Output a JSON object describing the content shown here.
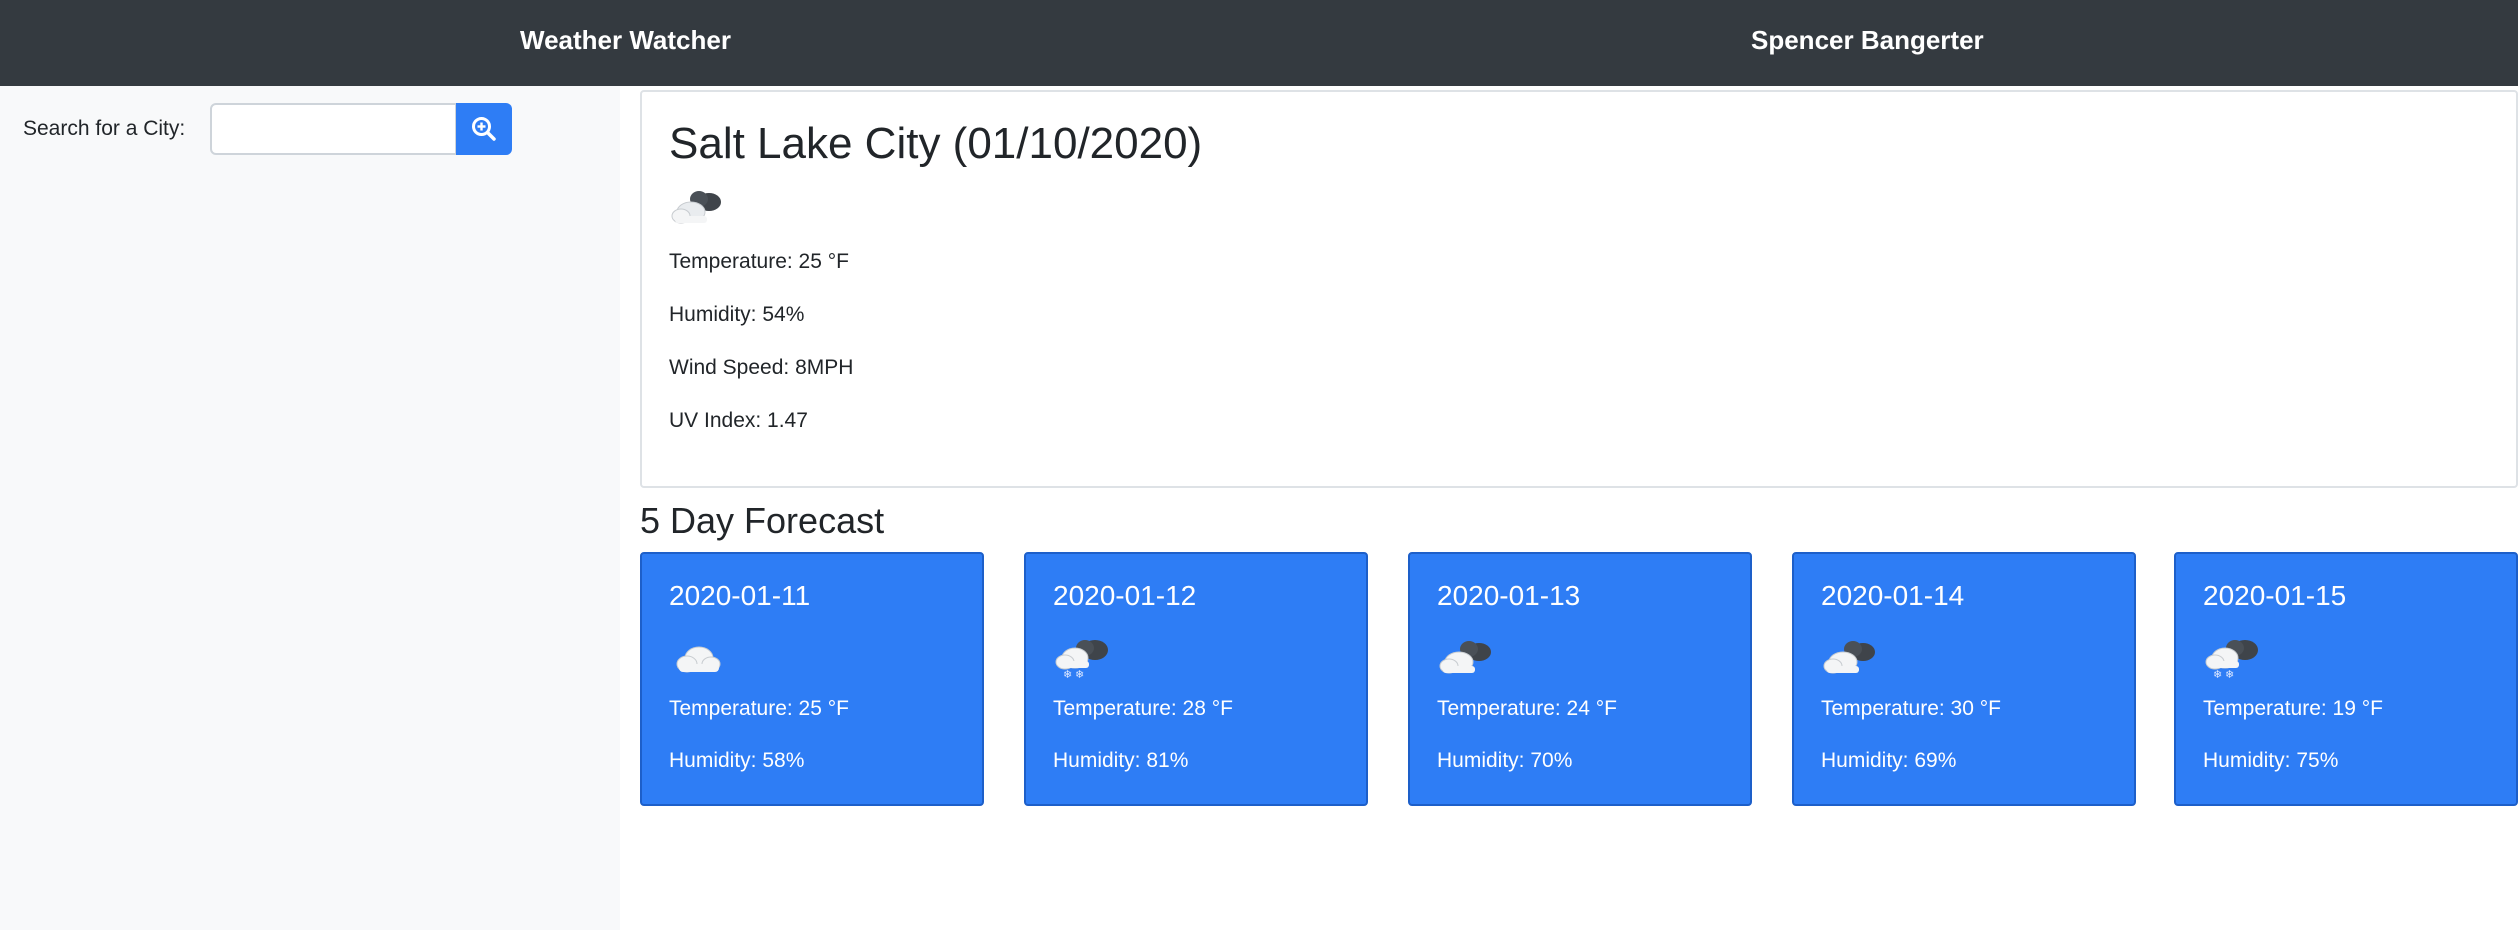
{
  "navbar": {
    "app_title": "Weather Watcher",
    "author": "Spencer Bangerter"
  },
  "search": {
    "label": "Search for a City:",
    "value": "",
    "placeholder": "",
    "button_icon": "search-zoom-icon"
  },
  "current": {
    "title": "Salt Lake City (01/10/2020)",
    "icon": "cloudy-icon",
    "temperature": "Temperature: 25 °F",
    "humidity": "Humidity: 54%",
    "wind": "Wind Speed: 8MPH",
    "uv": "UV Index: 1.47"
  },
  "forecast": {
    "heading": "5 Day Forecast",
    "days": [
      {
        "date": "2020-01-11",
        "icon": "cloud-icon",
        "temperature": "Temperature: 25 °F",
        "humidity": "Humidity: 58%"
      },
      {
        "date": "2020-01-12",
        "icon": "snow-icon",
        "temperature": "Temperature: 28 °F",
        "humidity": "Humidity: 81%"
      },
      {
        "date": "2020-01-13",
        "icon": "cloudy-icon",
        "temperature": "Temperature: 24 °F",
        "humidity": "Humidity: 70%"
      },
      {
        "date": "2020-01-14",
        "icon": "cloudy-icon",
        "temperature": "Temperature: 30 °F",
        "humidity": "Humidity: 69%"
      },
      {
        "date": "2020-01-15",
        "icon": "snow-icon",
        "temperature": "Temperature: 19 °F",
        "humidity": "Humidity: 75%"
      }
    ]
  },
  "colors": {
    "navbar": "#343a40",
    "sidebar": "#f8f9fa",
    "primary": "#2e7df5",
    "text": "#212529"
  }
}
